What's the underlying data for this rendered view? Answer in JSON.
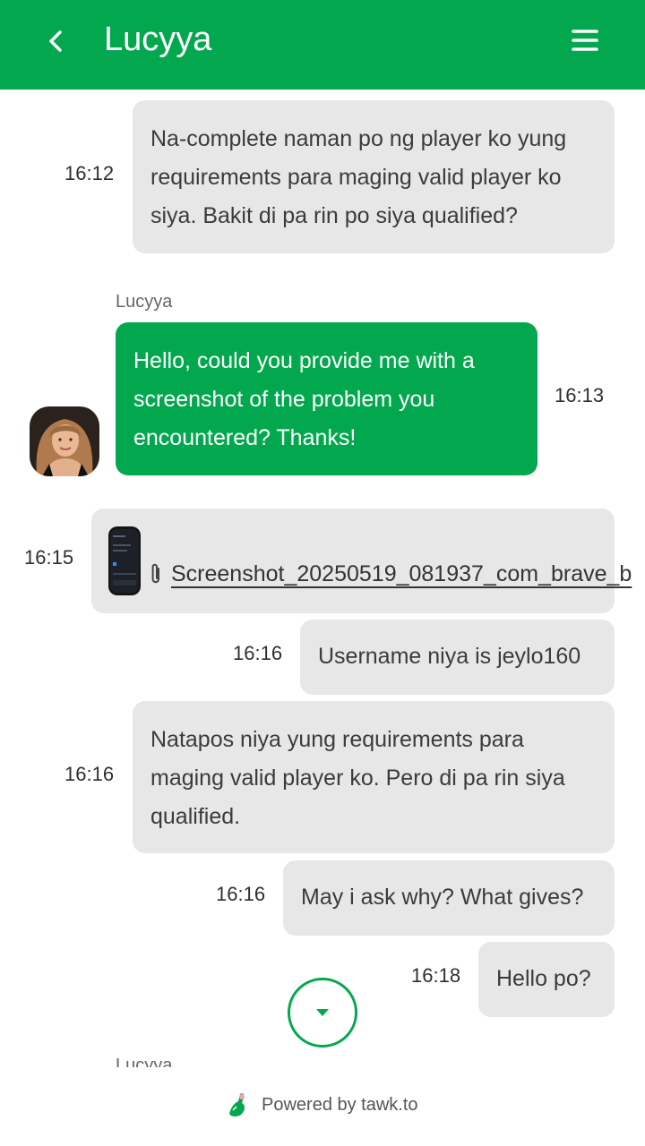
{
  "header": {
    "title": "Lucyya",
    "back_icon": "chevron-left-icon",
    "menu_icon": "hamburger-menu-icon",
    "color": "#03a84e"
  },
  "messages": [
    {
      "from": "visitor",
      "time": "16:12",
      "text": "Na-complete naman po ng player ko yung requirements para maging valid player ko siya. Bakit di pa rin po siya qualified?"
    },
    {
      "from": "agent",
      "sender": "Lucyya",
      "time": "16:13",
      "text": "Hello, could you provide me with a screenshot of the problem you encountered? Thanks!"
    },
    {
      "from": "visitor",
      "time": "16:15",
      "type": "file",
      "text": "Screenshot_20250519_081937_com_brave_b"
    },
    {
      "from": "visitor",
      "time": "16:16",
      "text": "Username niya is jeylo160"
    },
    {
      "from": "visitor",
      "time": "16:16",
      "text": "Natapos niya yung requirements para maging valid player ko. Pero di pa rin siya qualified."
    },
    {
      "from": "visitor",
      "time": "16:16",
      "text": "May i ask why? What gives?"
    },
    {
      "from": "visitor",
      "time": "16:18",
      "text": "Hello po?"
    }
  ],
  "partial_sender": "Lucyya",
  "footer": {
    "powered_by": "Powered by tawk.to"
  }
}
